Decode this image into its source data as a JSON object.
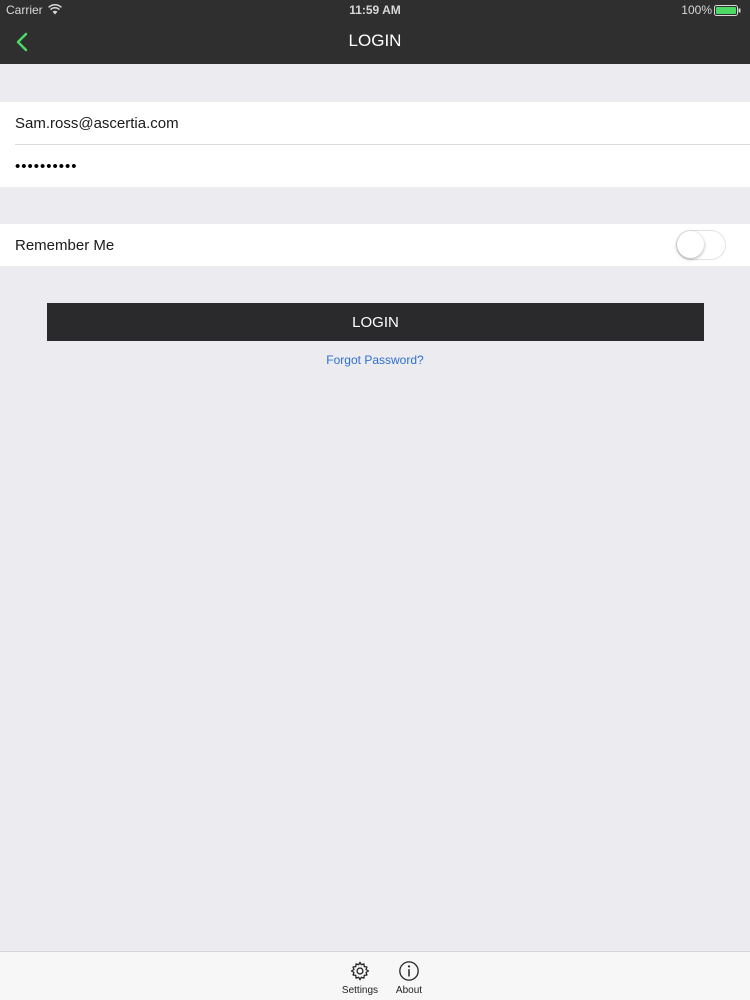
{
  "status_bar": {
    "carrier": "Carrier",
    "time": "11:59 AM",
    "battery": "100%"
  },
  "nav": {
    "title": "LOGIN",
    "back_icon": "chevron-left-icon",
    "accent_color": "#4cd964"
  },
  "form": {
    "email_value": "Sam.ross@ascertia.com",
    "password_mask": "••••••••••",
    "remember_label": "Remember Me",
    "remember_on": false,
    "login_button": "LOGIN",
    "forgot_link": "Forgot Password?"
  },
  "tab_bar": {
    "items": [
      {
        "label": "Settings",
        "icon": "gear-icon"
      },
      {
        "label": "About",
        "icon": "info-icon"
      }
    ]
  }
}
